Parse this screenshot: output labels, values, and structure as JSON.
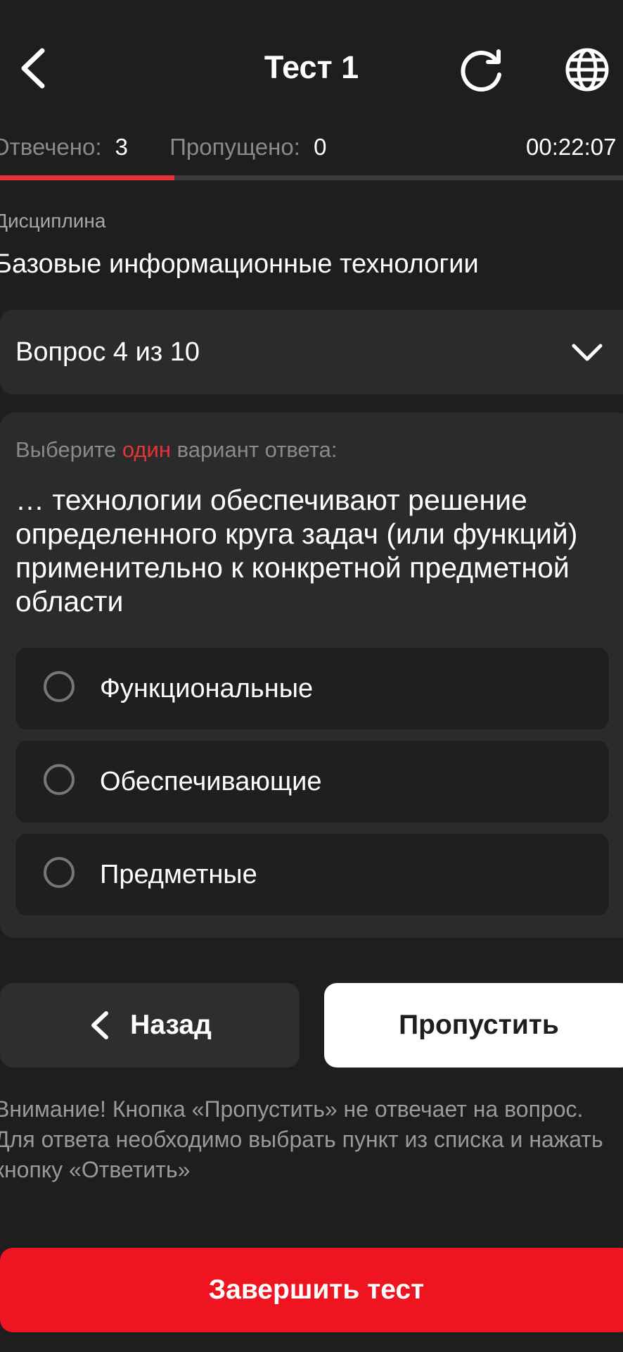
{
  "header": {
    "title": "Тест 1",
    "back_icon": "chevron-left-icon",
    "reload_icon": "reload-icon",
    "language_icon": "globe-icon"
  },
  "stats": {
    "answered_label": "Отвечено:",
    "answered_value": "3",
    "skipped_label": "Пропущено:",
    "skipped_value": "0",
    "timer": "00:22:07",
    "progress_fraction": 0.28
  },
  "discipline": {
    "label": "Дисциплина",
    "value": "Базовые информационные технологии"
  },
  "question_selector": {
    "label": "Вопрос 4 из 10",
    "icon": "chevron-down-icon"
  },
  "question": {
    "instruction_prefix": "Выберите ",
    "instruction_accent": "один",
    "instruction_suffix": " вариант ответа:",
    "text": "… технологии обеспечивают решение определенного круга задач (или функций) применительно к конкретной предметной области",
    "options": [
      {
        "label": "Функциональные"
      },
      {
        "label": "Обеспечивающие"
      },
      {
        "label": "Предметные"
      }
    ]
  },
  "buttons": {
    "back_label": "Назад",
    "skip_label": "Пропустить",
    "finish_label": "Завершить тест"
  },
  "warning": "Внимание! Кнопка «Пропустить» не отвечает на вопрос. Для ответа необходимо выбрать пункт из списка и нажать кнопку «Ответить»",
  "colors": {
    "background": "#1e1e1e",
    "accent_red": "#e8323a",
    "finish_button": "#ee1520",
    "card": "#2b2b2b"
  }
}
